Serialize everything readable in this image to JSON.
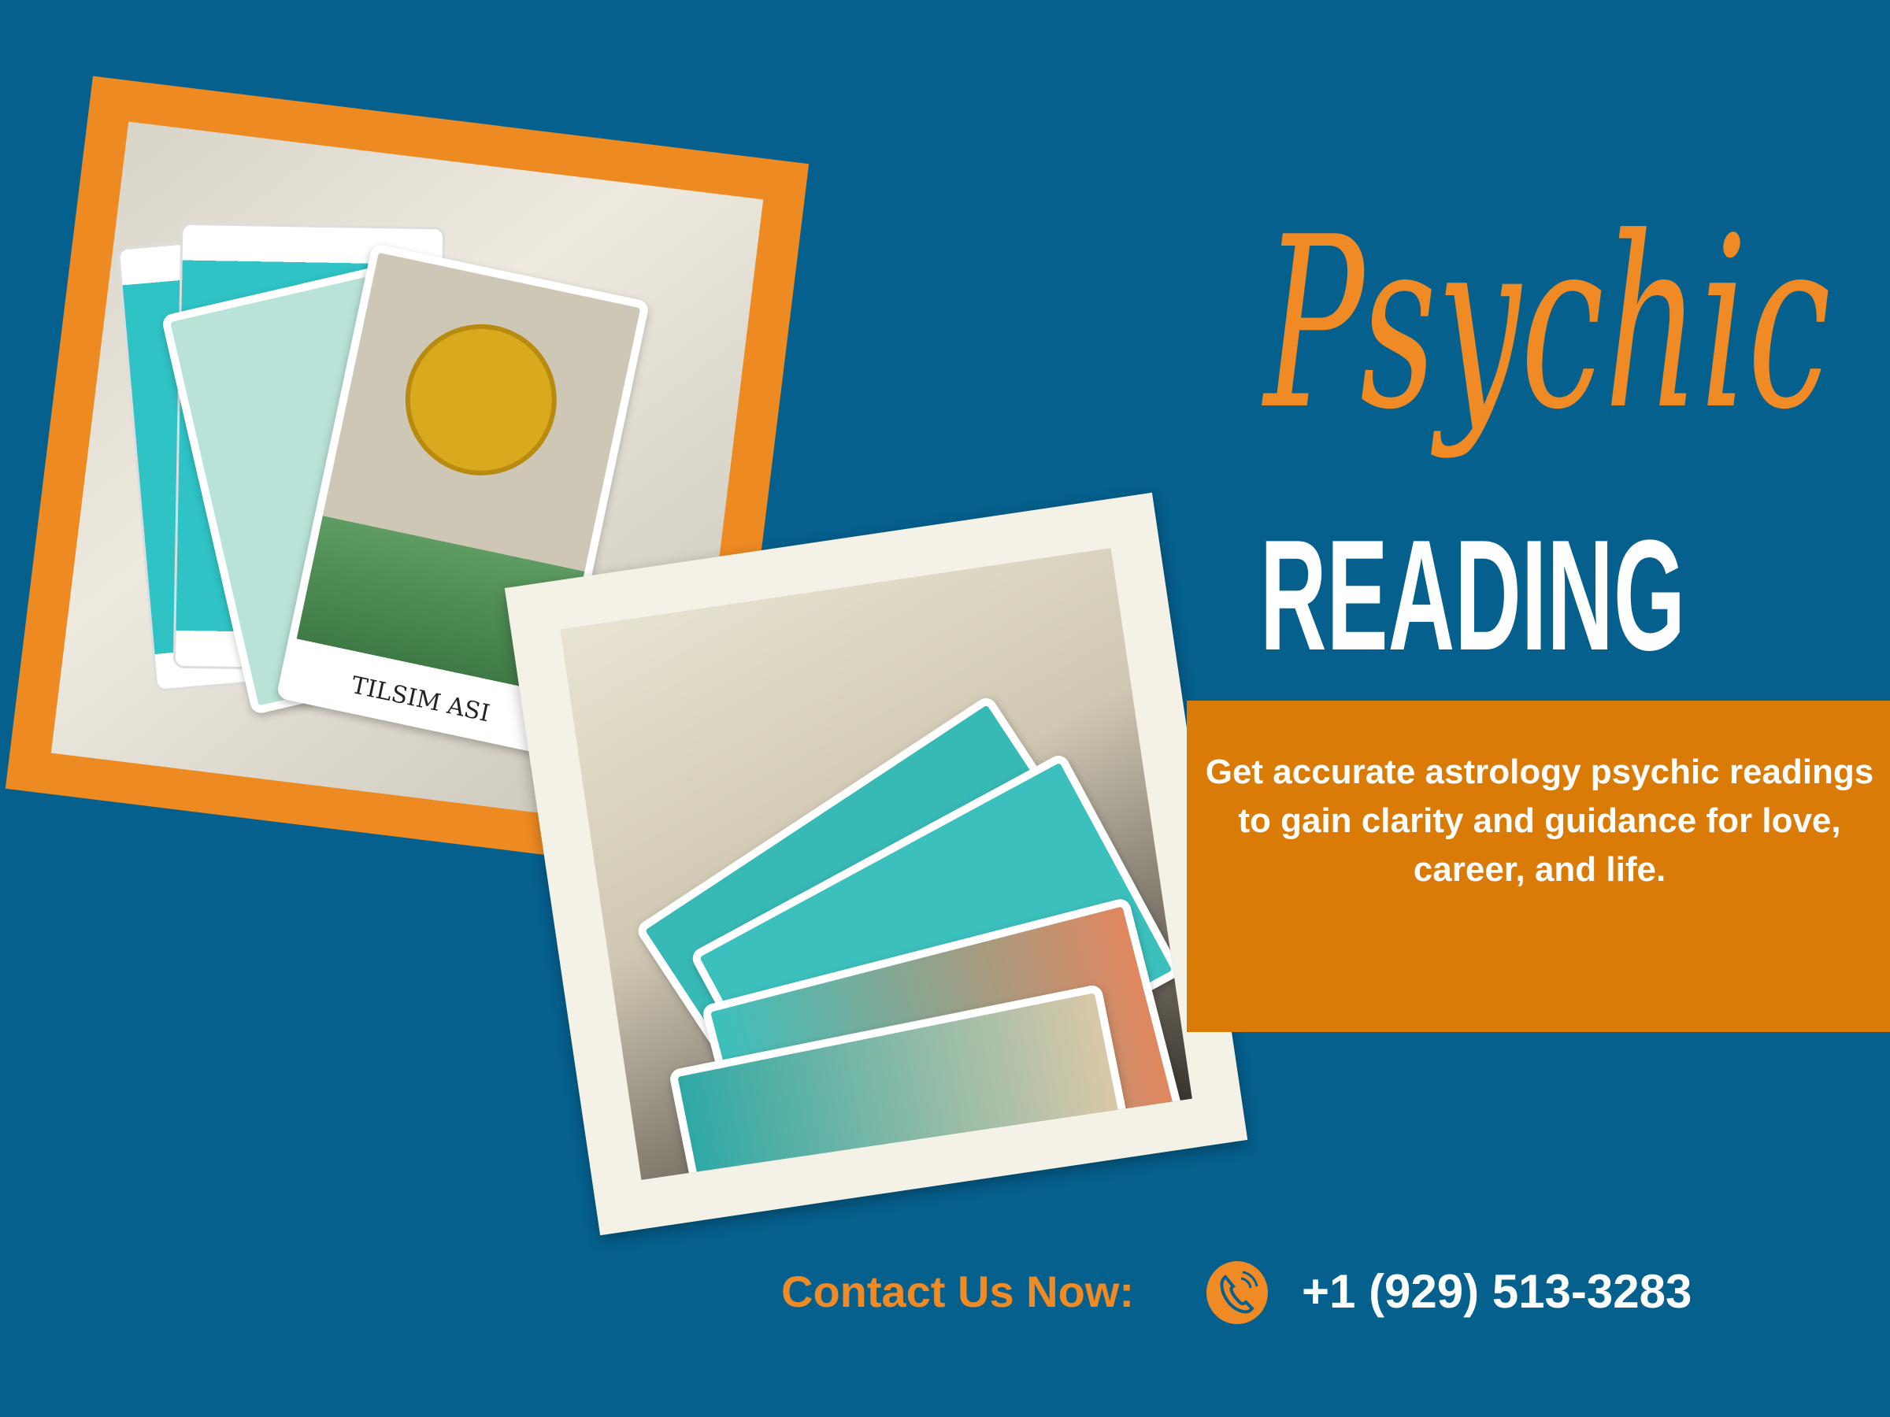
{
  "heading": {
    "script": "Psychic",
    "main": "READING"
  },
  "description": "Get accurate astrology psychic readings to gain clarity and guidance for love, career, and life.",
  "photo1": {
    "card_caption": "TILSIM ASI"
  },
  "contact": {
    "label": "Contact Us Now:",
    "icon": "phone-icon",
    "phone": "+1 (929) 513-3283"
  },
  "colors": {
    "background": "#05608e",
    "accent": "#f08a24",
    "band": "#d97b06"
  }
}
